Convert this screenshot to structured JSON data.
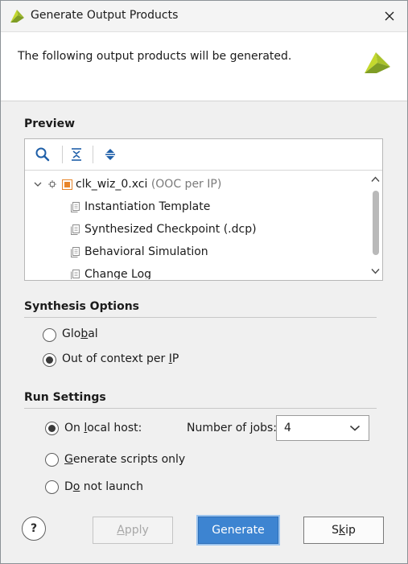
{
  "window": {
    "title": "Generate Output Products"
  },
  "header": {
    "message": "The following output products will be generated."
  },
  "preview": {
    "label": "Preview",
    "root": {
      "name": "clk_wiz_0.xci",
      "suffix": "(OOC per IP)"
    },
    "children": [
      "Instantiation Template",
      "Synthesized Checkpoint (.dcp)",
      "Behavioral Simulation",
      "Change Log"
    ]
  },
  "synthesis": {
    "label": "Synthesis Options",
    "options": [
      {
        "pre": "Glo",
        "key": "b",
        "post": "al",
        "checked": false
      },
      {
        "pre": "Out of context per ",
        "key": "I",
        "post": "P",
        "checked": true
      }
    ]
  },
  "run": {
    "label": "Run Settings",
    "options": [
      {
        "pre": "On ",
        "key": "l",
        "post": "ocal host:",
        "checked": true
      },
      {
        "pre": "",
        "key": "G",
        "post": "enerate scripts only",
        "checked": false
      },
      {
        "pre": "D",
        "key": "o",
        "post": " not launch",
        "checked": false
      }
    ],
    "jobs": {
      "pre": "Number of ",
      "key": "j",
      "post": "obs:",
      "value": "4"
    }
  },
  "buttons": {
    "help": "?",
    "apply": {
      "pre": "",
      "key": "A",
      "post": "pply"
    },
    "generate": "Generate",
    "skip": {
      "pre": "S",
      "key": "k",
      "post": "ip"
    }
  },
  "colors": {
    "primary_button": "#3d84d1",
    "logo_green_light": "#c4d82e",
    "logo_green_dark": "#7f9d25",
    "module_icon_orange": "#e8852a",
    "toolbar_icon_blue": "#1f5fa8"
  }
}
